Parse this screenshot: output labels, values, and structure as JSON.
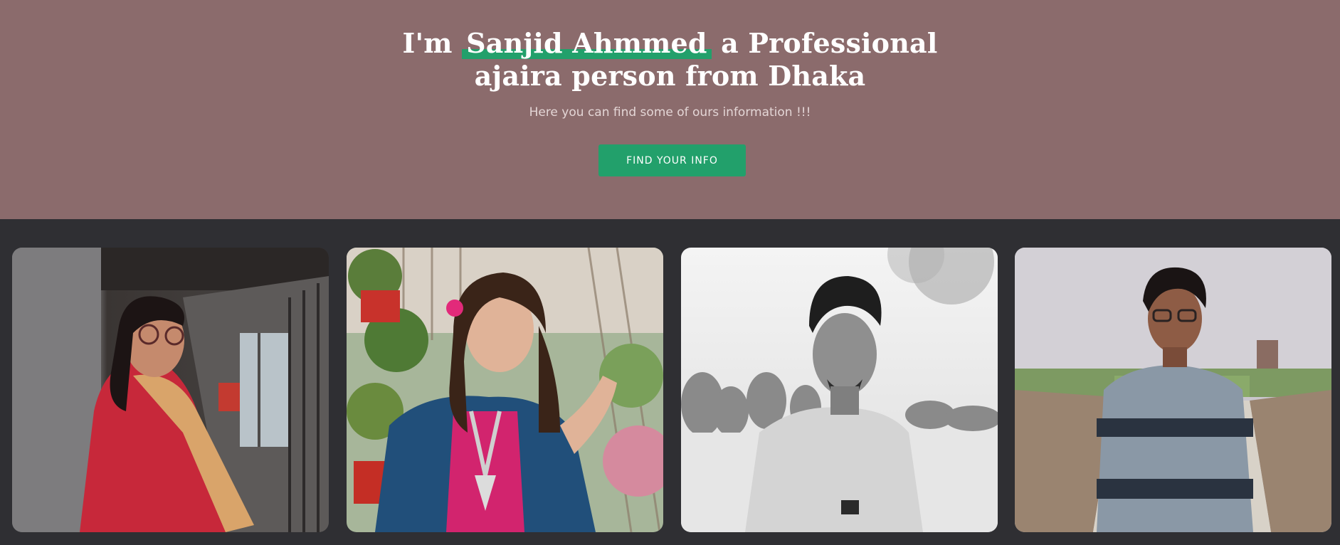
{
  "hero": {
    "headline_prefix": "I'm ",
    "headline_name": "Sanjid Ahmmed",
    "headline_suffix": " a Professional",
    "headline_line2": "ajaira person from Dhaka",
    "subtitle": "Here you can find some of ours information !!!",
    "cta_label": "FIND YOUR INFO"
  },
  "colors": {
    "hero_background": "#8b6b6c",
    "accent": "#22a06b",
    "page_background": "#2f2f33"
  },
  "gallery": {
    "photos": [
      {
        "description": "woman in red dress with glasses by staircase"
      },
      {
        "description": "woman in pink and blue outfit among plants"
      },
      {
        "description": "young man in black and white"
      },
      {
        "description": "young man in striped sweater outdoors"
      }
    ]
  }
}
